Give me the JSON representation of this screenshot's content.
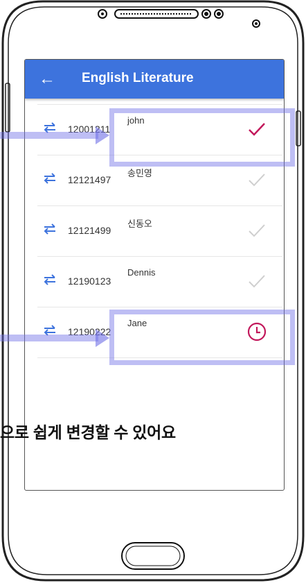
{
  "header": {
    "title": "English Literature",
    "back_icon": "arrow-left-icon"
  },
  "students": [
    {
      "id": "12001211",
      "name": "john",
      "status": "check"
    },
    {
      "id": "12121497",
      "name": "송민영",
      "status": "none"
    },
    {
      "id": "12121499",
      "name": "신동오",
      "status": "none"
    },
    {
      "id": "12190123",
      "name": "Dennis",
      "status": "none"
    },
    {
      "id": "12190222",
      "name": "Jane",
      "status": "clock"
    }
  ],
  "caption": "으로 쉽게 변경할 수 있어요",
  "colors": {
    "appbar": "#3d73dd",
    "accent": "#c2185b",
    "highlight": "#6e6ee6",
    "swap_icon": "#3d73dd"
  }
}
